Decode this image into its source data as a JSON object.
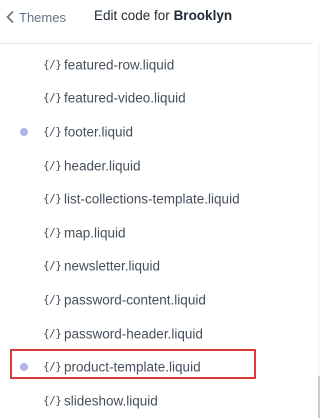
{
  "header": {
    "back_label": "Themes",
    "title_prefix": "Edit code for",
    "theme_name": "Brooklyn"
  },
  "colors": {
    "modified_dot": "#b3b5e8",
    "highlight": "#d93a3a"
  },
  "files": [
    {
      "name": "featured-row.liquid",
      "modified": false
    },
    {
      "name": "featured-video.liquid",
      "modified": false
    },
    {
      "name": "footer.liquid",
      "modified": true
    },
    {
      "name": "header.liquid",
      "modified": false
    },
    {
      "name": "list-collections-template.liquid",
      "modified": false
    },
    {
      "name": "map.liquid",
      "modified": false
    },
    {
      "name": "newsletter.liquid",
      "modified": false
    },
    {
      "name": "password-content.liquid",
      "modified": false
    },
    {
      "name": "password-header.liquid",
      "modified": false
    },
    {
      "name": "product-template.liquid",
      "modified": true,
      "highlighted": true
    },
    {
      "name": "slideshow.liquid",
      "modified": false
    }
  ]
}
